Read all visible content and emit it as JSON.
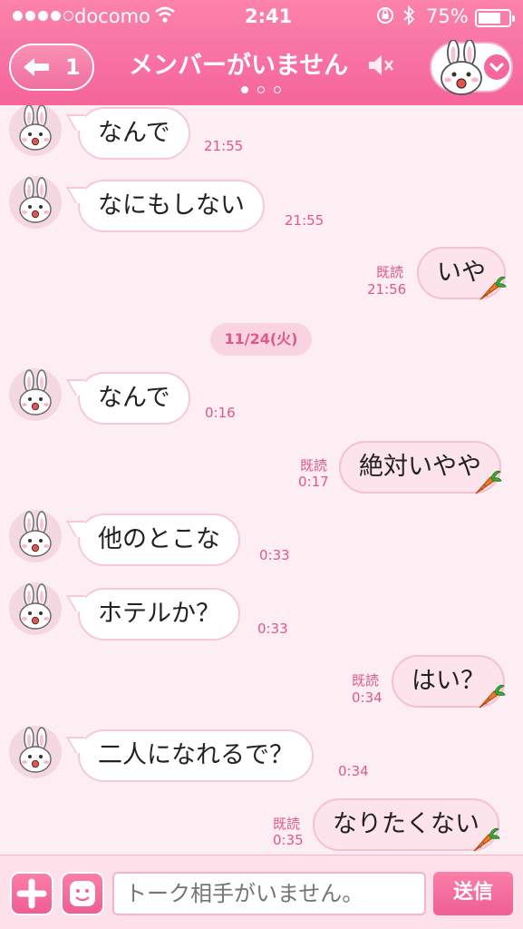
{
  "status_bar": {
    "carrier": "docomo",
    "time": "2:41",
    "battery_percent": "75%",
    "battery_level": 0.75,
    "signal_bars_filled": 4,
    "signal_bars_total": 5
  },
  "header": {
    "back_count": "1",
    "title": "メンバーがいません",
    "page_indicator_active": 1,
    "page_indicator_total": 3
  },
  "messages": [
    {
      "side": "in",
      "text": "なんで",
      "time": "21:55"
    },
    {
      "side": "in",
      "text": "なにもしない",
      "time": "21:55"
    },
    {
      "side": "out",
      "text": "いや",
      "read": "既読",
      "time": "21:56"
    },
    {
      "side": "date",
      "text": "11/24(火)"
    },
    {
      "side": "in",
      "text": "なんで",
      "time": "0:16"
    },
    {
      "side": "out",
      "text": "絶対いやや",
      "read": "既読",
      "time": "0:17"
    },
    {
      "side": "in",
      "text": "他のとこな",
      "time": "0:33"
    },
    {
      "side": "in",
      "text": "ホテルか？",
      "time": "0:33"
    },
    {
      "side": "out",
      "text": "はい？",
      "read": "既読",
      "time": "0:34"
    },
    {
      "side": "in",
      "text": "二人になれるで？",
      "time": "0:34"
    },
    {
      "side": "out",
      "text": "なりたくない",
      "read": "既読",
      "time": "0:35"
    }
  ],
  "input": {
    "placeholder": "トーク相手がいません。",
    "send_label": "送信"
  },
  "colors": {
    "header_pink": "#f5659a",
    "chat_background": "#fdeef3",
    "accent_text": "#e05788"
  }
}
